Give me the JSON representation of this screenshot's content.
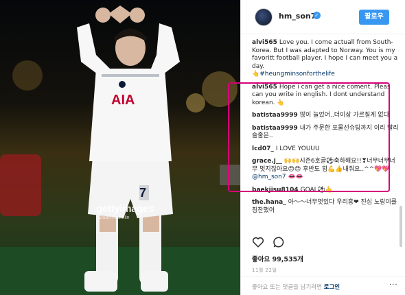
{
  "post": {
    "username": "hm_son7",
    "verified_symbol": "✓",
    "follow_label": "팔로우",
    "likes_text": "좋아요 99,535개",
    "date": "11월 22일",
    "login_prompt": "좋아요 또는 댓글을 남기려면",
    "login_link": "로그인",
    "more_dots": "···"
  },
  "photo": {
    "watermark": "gettyimages",
    "credit": "Stuart Franklin",
    "jersey_sponsor": "AIA",
    "jersey_number": "7"
  },
  "comments": [
    {
      "user": "alvi565",
      "text": "Love you. I come actuall from South- Korea. But I was adapted to Norway. You is my favoritt football player. I hope I can meet you a day.",
      "hashtag": "👆#heungminsonforthelife"
    },
    {
      "user": "alvi565",
      "text": "Hope i can get a nice coment. Pleas can you write in english. I dont understand korean. 👆"
    },
    {
      "user": "batistaa9999",
      "text": "많이 늘었어..더이상 가르칠게 없다"
    },
    {
      "user": "batistaa9999",
      "text": "내가 주문한 포물선슈팅까지 이리 빨리슬줄은.."
    },
    {
      "user": "lcd07_",
      "text": "I LOVE YOUUU"
    },
    {
      "user": "grace.j__",
      "text": "🙌🙌시즌6호골⚽축하해요!!❣너무너무너무 멋지잖아요😍😍 후반도 힘💪👍내줘요..^^💖💖",
      "mention": "@hm_son7 👄👄"
    },
    {
      "user": "baekjisu8104",
      "text": "GOAL⚽👆"
    },
    {
      "user": "the.hana_",
      "text": "아〜〜너무멋있다 우리흥❤ 진심 노랑이를 칭찬했어"
    }
  ],
  "icons": {
    "heart": "heart-icon",
    "comment": "comment-icon",
    "verified": "verified-badge-icon"
  },
  "colors": {
    "accent": "#3897f0",
    "highlight_box": "#d6007a",
    "link": "#003569"
  }
}
